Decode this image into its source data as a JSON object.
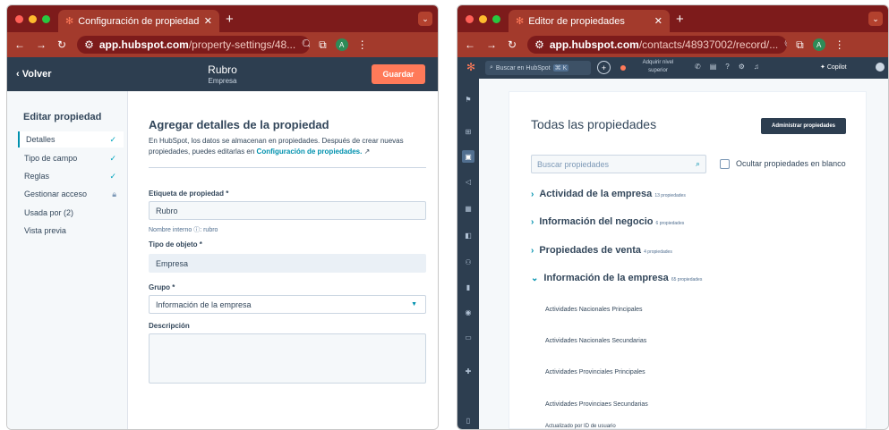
{
  "colors": {
    "brand_orange": "#ff7a59",
    "nav_dark": "#2d3e50",
    "browser_red": "#7d1b1b",
    "link_teal": "#0091ae"
  },
  "window1": {
    "tab_title": "Configuración de propiedade",
    "url_domain": "app.hubspot.com",
    "url_path": "/property-settings/48...",
    "back_label": "Volver",
    "record_title": "Rubro",
    "record_sub": "Empresa",
    "save_label": "Guardar",
    "sidebar_title": "Editar propiedad",
    "sidebar_items": [
      {
        "label": "Detalles",
        "status": "check-icon"
      },
      {
        "label": "Tipo de campo",
        "status": "check-icon"
      },
      {
        "label": "Reglas",
        "status": "check-icon"
      },
      {
        "label": "Gestionar acceso",
        "status": "lock-icon"
      },
      {
        "label": "Usada por (2)",
        "status": ""
      },
      {
        "label": "Vista previa",
        "status": ""
      }
    ],
    "heading": "Agregar detalles de la propiedad",
    "description": "En HubSpot, los datos se almacenan en propiedades. Después de crear nuevas propiedades, puedes editarlas en",
    "description_link": "Configuración de propiedades.",
    "label_field": "Etiqueta de propiedad *",
    "label_value": "Rubro",
    "internal_name_label": "Nombre interno",
    "internal_name_value": "rubro",
    "object_type_label": "Tipo de objeto *",
    "object_type_value": "Empresa",
    "group_label": "Grupo *",
    "group_value": "Información de la empresa",
    "description_label": "Descripción"
  },
  "window2": {
    "tab_title": "Editor de propiedades",
    "url_domain": "app.hubspot.com",
    "url_path": "/contacts/48937002/record/...",
    "search_placeholder": "Buscar en HubSpot",
    "search_keys": "⌘ K",
    "upgrade_line1": "Adquirir nivel",
    "upgrade_line2": "superior",
    "copilot_label": "Copilot",
    "card_title": "Todas las propiedades",
    "manage_label": "Administrar propiedades",
    "prop_search_placeholder": "Buscar propiedades",
    "hide_blank_label": "Ocultar propiedades en blanco",
    "sections": [
      {
        "title": "Actividad de la empresa",
        "count": "13 propiedades",
        "expanded": false
      },
      {
        "title": "Información del negocio",
        "count": "6 propiedades",
        "expanded": false
      },
      {
        "title": "Propiedades de venta",
        "count": "4 propiedades",
        "expanded": false
      },
      {
        "title": "Información de la empresa",
        "count": "65 propiedades",
        "expanded": true
      }
    ],
    "properties": [
      "Actividades Nacionales Principales",
      "Actividades Nacionales Secundarias",
      "Actividades Provinciales Principales",
      "Actividades Provinciaes Secundarias",
      "Actualizado por ID de usuario"
    ]
  }
}
